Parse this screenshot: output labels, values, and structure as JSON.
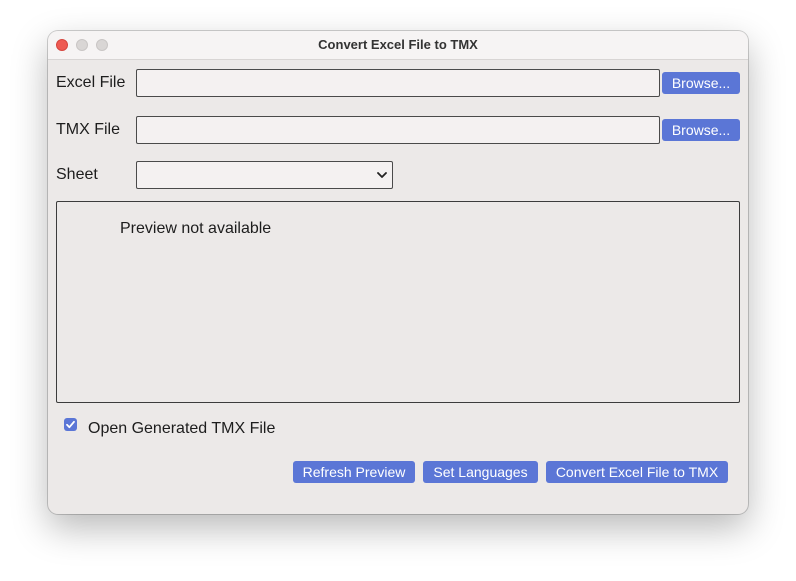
{
  "window": {
    "title": "Convert Excel File to TMX"
  },
  "form": {
    "excel_file_label": "Excel File",
    "excel_file_value": "",
    "tmx_file_label": "TMX File",
    "tmx_file_value": "",
    "browse_label": "Browse...",
    "sheet_label": "Sheet",
    "sheet_value": ""
  },
  "preview": {
    "text": "Preview not available"
  },
  "options": {
    "open_generated_label": "Open Generated TMX File",
    "open_generated_checked": true
  },
  "actions": {
    "refresh_preview": "Refresh Preview",
    "set_languages": "Set Languages",
    "convert": "Convert Excel File to TMX"
  },
  "colors": {
    "accent": "#5b76d6",
    "window_bg": "#ece9e8",
    "close_button": "#ee5a52"
  },
  "icons": {
    "close": "close-icon",
    "minimize": "minimize-icon",
    "maximize": "maximize-icon",
    "dropdown": "chevron-down-icon",
    "checkbox": "checkmark-icon"
  }
}
